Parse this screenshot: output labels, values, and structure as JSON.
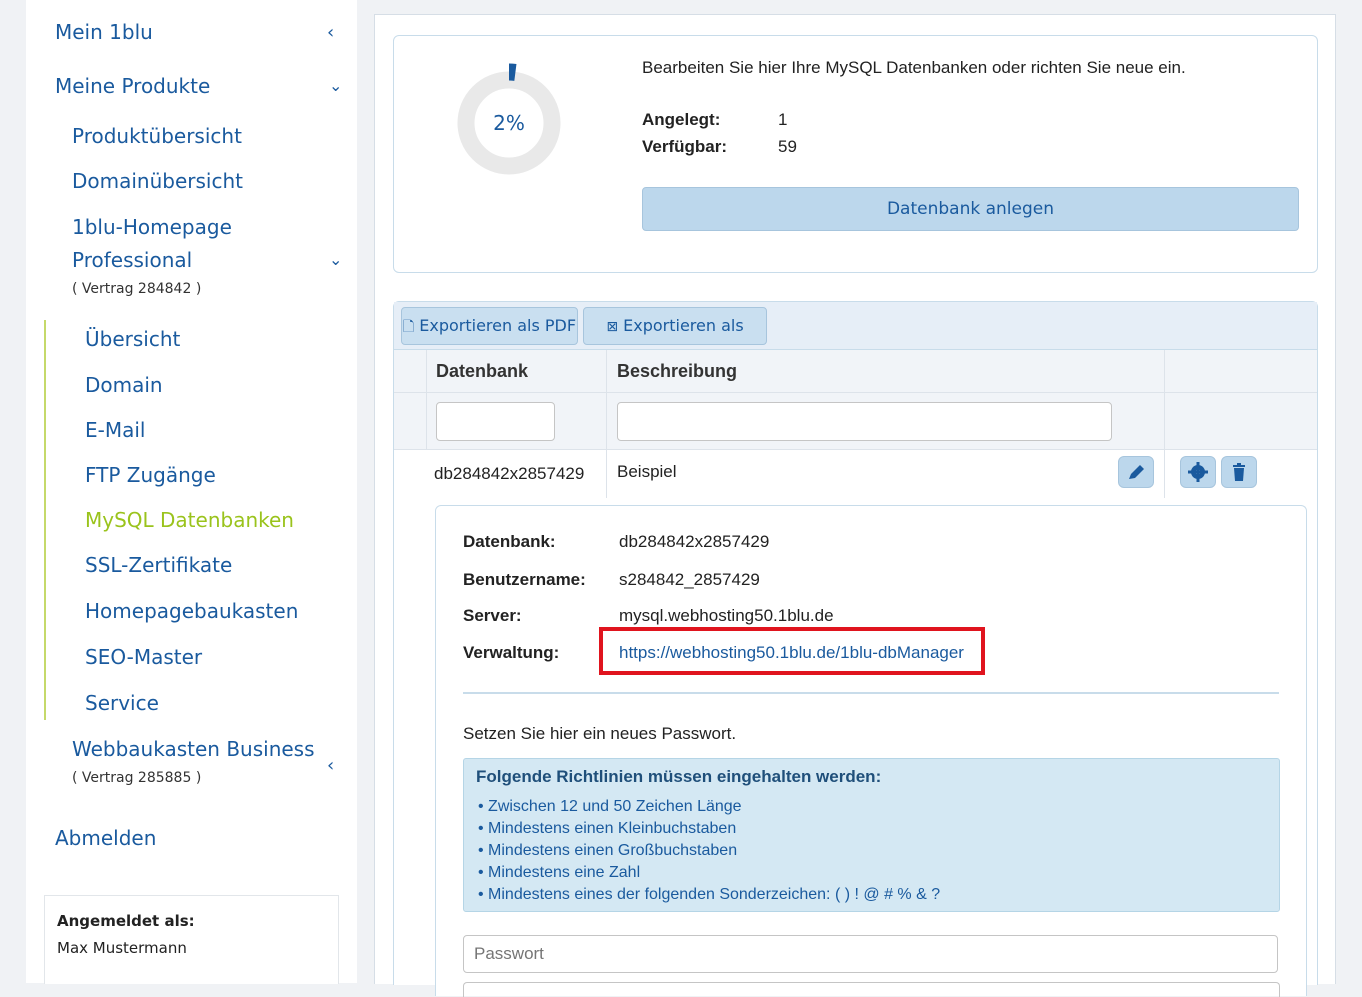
{
  "sidebar": {
    "mein": "Mein 1blu",
    "produkte": "Meine Produkte",
    "produktuebersicht": "Produktübersicht",
    "domainuebersicht": "Domainübersicht",
    "homepage_line1": "1blu-Homepage",
    "homepage_line2": "Professional",
    "homepage_contract": "( Vertrag 284842 )",
    "sub": {
      "uebersicht": "Übersicht",
      "domain": "Domain",
      "email": "E-Mail",
      "ftp": "FTP Zugänge",
      "mysql": "MySQL Datenbanken",
      "ssl": "SSL-Zertifikate",
      "baukasten": "Homepagebaukasten",
      "seo": "SEO-Master",
      "service": "Service"
    },
    "webbaukasten": "Webbaukasten Business",
    "webbaukasten_contract": "( Vertrag 285885 )",
    "abmelden": "Abmelden",
    "login_label": "Angemeldet als:",
    "login_user": "Max Mustermann"
  },
  "summary": {
    "percent_text": "2%",
    "usage_fraction": 0.02,
    "intro": "Bearbeiten Sie hier Ihre MySQL Datenbanken oder richten Sie neue ein.",
    "angelegt_label": "Angelegt:",
    "angelegt_value": "1",
    "verfuegbar_label": "Verfügbar:",
    "verfuegbar_value": "59",
    "create_button": "Datenbank anlegen"
  },
  "table": {
    "export_pdf": "Exportieren als PDF",
    "export_excel": "Exportieren als Excel",
    "col_db": "Datenbank",
    "col_desc": "Beschreibung",
    "row": {
      "db": "db284842x2857429",
      "desc": "Beispiel"
    }
  },
  "details": {
    "db_label": "Datenbank:",
    "db_value": "db284842x2857429",
    "user_label": "Benutzername:",
    "user_value": "s284842_2857429",
    "server_label": "Server:",
    "server_value": "mysql.webhosting50.1blu.de",
    "admin_label": "Verwaltung:",
    "admin_link": "https://webhosting50.1blu.de/1blu-dbManager",
    "password_intro": "Setzen Sie hier ein neues Passwort.",
    "rules_title": "Folgende Richtlinien müssen eingehalten werden:",
    "rules": [
      "Zwischen 12 und 50 Zeichen Länge",
      "Mindestens einen Kleinbuchstaben",
      "Mindestens einen Großbuchstaben",
      "Mindestens eine Zahl",
      "Mindestens eines der folgenden Sonderzeichen: ( ) ! @ # % & ?"
    ],
    "password_placeholder": "Passwort"
  },
  "colors": {
    "accent": "#1a5a9e",
    "active": "#9ac31c",
    "highlight": "#e0141e"
  },
  "icons": [
    "chevron-left-icon",
    "chevron-down-icon",
    "pdf-icon",
    "excel-icon",
    "pencil-icon",
    "gear-icon",
    "trash-icon"
  ]
}
